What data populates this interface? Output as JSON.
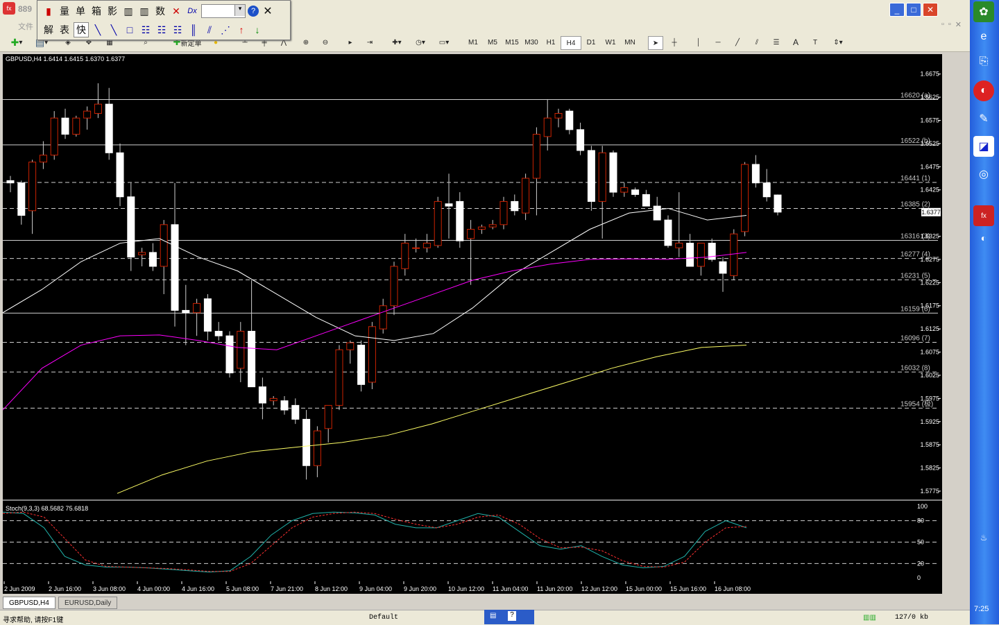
{
  "window": {
    "title": "889"
  },
  "floating_toolbar": {
    "row1": [
      "量",
      "单",
      "箱",
      "影",
      "数"
    ],
    "row2": [
      "解",
      "表",
      "快"
    ]
  },
  "menu_stub": "文件",
  "toolbar": {
    "new_order_label": "新定单",
    "timeframes": [
      "M1",
      "M5",
      "M15",
      "M30",
      "H1",
      "H4",
      "D1",
      "W1",
      "MN"
    ],
    "active_timeframe": "H4"
  },
  "chart": {
    "symbol_header": "GBPUSD,H4  1.6414 1.6415 1.6370 1.6377",
    "price_ticks": [
      "1.6675",
      "1.6625",
      "1.6575",
      "1.6525",
      "1.6475",
      "1.6425",
      "1.6325",
      "1.6275",
      "1.6225",
      "1.6175",
      "1.6125",
      "1.6075",
      "1.6025",
      "1.5975",
      "1.5925",
      "1.5875",
      "1.5825",
      "1.5775"
    ],
    "current_price": "1.6377",
    "levels": [
      {
        "label": "16620 (a)",
        "price": 1.662,
        "style": "solid"
      },
      {
        "label": "16522 (b)",
        "price": 1.6522,
        "style": "solid"
      },
      {
        "label": "16441 (1)",
        "price": 1.6441,
        "style": "dash"
      },
      {
        "label": "16385 (2)",
        "price": 1.6385,
        "style": "dash"
      },
      {
        "label": "16316 (3)",
        "price": 1.6316,
        "style": "solid"
      },
      {
        "label": "16277 (4)",
        "price": 1.6277,
        "style": "dash"
      },
      {
        "label": "16231 (5)",
        "price": 1.6231,
        "style": "dash"
      },
      {
        "label": "16159 (6)",
        "price": 1.6159,
        "style": "solid"
      },
      {
        "label": "16096 (7)",
        "price": 1.6096,
        "style": "dash"
      },
      {
        "label": "16032 (8)",
        "price": 1.6032,
        "style": "dash"
      },
      {
        "label": "15954 (极)",
        "price": 1.5954,
        "style": "dash"
      }
    ],
    "time_labels": [
      "2 Jun 2009",
      "2 Jun 16:00",
      "3 Jun 08:00",
      "4 Jun 00:00",
      "4 Jun 16:00",
      "5 Jun 08:00",
      "7 Jun 21:00",
      "8 Jun 12:00",
      "9 Jun 04:00",
      "9 Jun 20:00",
      "10 Jun 12:00",
      "11 Jun 04:00",
      "11 Jun 20:00",
      "12 Jun 12:00",
      "15 Jun 00:00",
      "15 Jun 16:00",
      "16 Jun 08:00"
    ],
    "stoch_header": "Stoch(9,3,3) 68.5682 75.6818",
    "stoch_ticks": [
      "100",
      "80",
      "50",
      "20",
      "0"
    ]
  },
  "chart_data": {
    "type": "candlestick",
    "title": "GBPUSD,H4",
    "ylim": [
      1.576,
      1.67
    ],
    "candles": [
      [
        1.6445,
        1.6455,
        1.642,
        1.644
      ],
      [
        1.644,
        1.6445,
        1.635,
        1.637
      ],
      [
        1.638,
        1.649,
        1.633,
        1.6485
      ],
      [
        1.6485,
        1.653,
        1.647,
        1.65
      ],
      [
        1.65,
        1.6595,
        1.649,
        1.658
      ],
      [
        1.658,
        1.66,
        1.6535,
        1.6545
      ],
      [
        1.6545,
        1.6585,
        1.654,
        1.658
      ],
      [
        1.658,
        1.6605,
        1.6555,
        1.6595
      ],
      [
        1.659,
        1.6655,
        1.658,
        1.661
      ],
      [
        1.661,
        1.6645,
        1.649,
        1.6505
      ],
      [
        1.6505,
        1.6525,
        1.639,
        1.641
      ],
      [
        1.641,
        1.644,
        1.625,
        1.628
      ],
      [
        1.6285,
        1.63,
        1.626,
        1.629
      ],
      [
        1.629,
        1.631,
        1.625,
        1.626
      ],
      [
        1.626,
        1.636,
        1.62,
        1.635
      ],
      [
        1.635,
        1.644,
        1.613,
        1.6165
      ],
      [
        1.6165,
        1.622,
        1.609,
        1.616
      ],
      [
        1.616,
        1.619,
        1.611,
        1.618
      ],
      [
        1.619,
        1.62,
        1.61,
        1.612
      ],
      [
        1.612,
        1.614,
        1.61,
        1.611
      ],
      [
        1.611,
        1.612,
        1.602,
        1.603
      ],
      [
        1.604,
        1.614,
        1.601,
        1.612
      ],
      [
        1.612,
        1.623,
        1.6,
        1.6
      ],
      [
        1.6,
        1.602,
        1.593,
        1.5965
      ],
      [
        1.597,
        1.598,
        1.596,
        1.5975
      ],
      [
        1.597,
        1.598,
        1.594,
        1.595
      ],
      [
        1.596,
        1.5975,
        1.592,
        1.593
      ],
      [
        1.593,
        1.595,
        1.58,
        1.583
      ],
      [
        1.583,
        1.5915,
        1.5805,
        1.5905
      ],
      [
        1.591,
        1.596,
        1.588,
        1.596
      ],
      [
        1.596,
        1.609,
        1.595,
        1.608
      ],
      [
        1.608,
        1.61,
        1.605,
        1.6095
      ],
      [
        1.609,
        1.61,
        1.599,
        1.6005
      ],
      [
        1.601,
        1.614,
        1.5995,
        1.613
      ],
      [
        1.6125,
        1.619,
        1.6115,
        1.6175
      ],
      [
        1.6175,
        1.627,
        1.6155,
        1.626
      ],
      [
        1.6255,
        1.633,
        1.624,
        1.631
      ],
      [
        1.63,
        1.632,
        1.629,
        1.63
      ],
      [
        1.63,
        1.633,
        1.629,
        1.631
      ],
      [
        1.6305,
        1.641,
        1.63,
        1.64
      ],
      [
        1.6395,
        1.646,
        1.632,
        1.639
      ],
      [
        1.64,
        1.642,
        1.63,
        1.6315
      ],
      [
        1.632,
        1.636,
        1.622,
        1.634
      ],
      [
        1.634,
        1.635,
        1.633,
        1.6345
      ],
      [
        1.6345,
        1.636,
        1.634,
        1.635
      ],
      [
        1.635,
        1.641,
        1.634,
        1.64
      ],
      [
        1.64,
        1.6415,
        1.637,
        1.638
      ],
      [
        1.6375,
        1.646,
        1.636,
        1.645
      ],
      [
        1.645,
        1.656,
        1.637,
        1.6545
      ],
      [
        1.654,
        1.662,
        1.651,
        1.658
      ],
      [
        1.658,
        1.66,
        1.656,
        1.659
      ],
      [
        1.6595,
        1.66,
        1.6545,
        1.6555
      ],
      [
        1.6555,
        1.657,
        1.65,
        1.651
      ],
      [
        1.651,
        1.652,
        1.638,
        1.64
      ],
      [
        1.64,
        1.652,
        1.632,
        1.6505
      ],
      [
        1.6505,
        1.651,
        1.641,
        1.642
      ],
      [
        1.642,
        1.644,
        1.641,
        1.643
      ],
      [
        1.6425,
        1.643,
        1.641,
        1.6415
      ],
      [
        1.6415,
        1.6425,
        1.639,
        1.639
      ],
      [
        1.639,
        1.641,
        1.636,
        1.636
      ],
      [
        1.636,
        1.637,
        1.63,
        1.6305
      ],
      [
        1.63,
        1.642,
        1.628,
        1.631
      ],
      [
        1.631,
        1.633,
        1.626,
        1.626
      ],
      [
        1.626,
        1.631,
        1.624,
        1.631
      ],
      [
        1.631,
        1.632,
        1.627,
        1.6275
      ],
      [
        1.627,
        1.628,
        1.6205,
        1.6245
      ],
      [
        1.624,
        1.634,
        1.623,
        1.633
      ],
      [
        1.6335,
        1.6485,
        1.6325,
        1.648
      ],
      [
        1.648,
        1.65,
        1.643,
        1.644
      ],
      [
        1.644,
        1.647,
        1.64,
        1.641
      ],
      [
        1.6414,
        1.6415,
        1.637,
        1.6377
      ]
    ],
    "series": [
      {
        "name": "white-ma",
        "color": "#ffffff"
      },
      {
        "name": "magenta-ma",
        "color": "#ff00ff"
      },
      {
        "name": "yellow-ma",
        "color": "#ffff66"
      }
    ],
    "ma_white": [
      1.616,
      1.621,
      1.627,
      1.631,
      1.632,
      1.628,
      1.625,
      1.62,
      1.615,
      1.611,
      1.61,
      1.6115,
      1.617,
      1.624,
      1.629,
      1.634,
      1.6375,
      1.6385,
      1.636,
      1.637
    ],
    "ma_magenta": [
      1.595,
      1.604,
      1.609,
      1.611,
      1.6112,
      1.61,
      1.6085,
      1.608,
      1.611,
      1.614,
      1.617,
      1.62,
      1.623,
      1.625,
      1.6265,
      1.6275,
      1.6276,
      1.6275,
      1.628,
      1.629
    ],
    "ma_yellow": [
      1.577,
      1.581,
      1.584,
      1.586,
      1.587,
      1.588,
      1.5895,
      1.592,
      1.595,
      1.598,
      1.601,
      1.604,
      1.6065,
      1.6085,
      1.609
    ],
    "stoch_k": [
      92,
      90,
      70,
      30,
      18,
      15,
      15,
      14,
      12,
      10,
      8,
      10,
      30,
      60,
      80,
      90,
      92,
      91,
      88,
      75,
      70,
      70,
      80,
      90,
      85,
      65,
      45,
      40,
      45,
      30,
      18,
      14,
      16,
      30,
      65,
      80,
      70
    ],
    "stoch_d": [
      90,
      92,
      85,
      55,
      25,
      16,
      15,
      14,
      13,
      11,
      9,
      9,
      20,
      45,
      70,
      85,
      90,
      92,
      90,
      82,
      75,
      70,
      75,
      85,
      88,
      75,
      55,
      42,
      43,
      38,
      24,
      16,
      15,
      22,
      50,
      70,
      72
    ],
    "stoch_ylim": [
      0,
      100
    ]
  },
  "tabs": [
    {
      "label": "GBPUSD,H4",
      "active": true
    },
    {
      "label": "EURUSD,Daily",
      "active": false
    }
  ],
  "status": {
    "help": "寻求帮助, 请按F1键",
    "profile": "Default",
    "traffic": "127/0 kb"
  },
  "clock": "7:25"
}
